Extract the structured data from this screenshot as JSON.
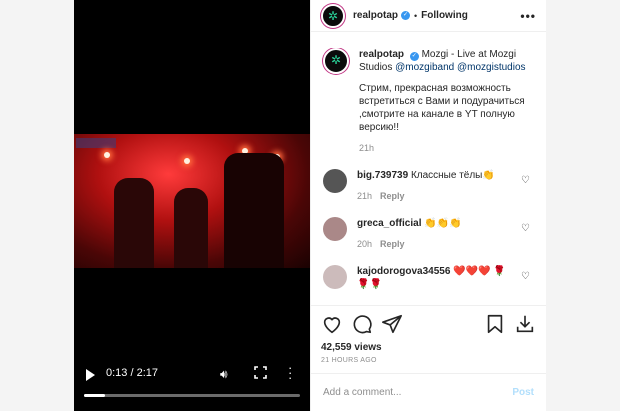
{
  "video": {
    "time": "0:13 / 2:17",
    "progress": 0.095
  },
  "header": {
    "username": "realpotap",
    "dot": "•",
    "follow": "Following",
    "more": "•••"
  },
  "caption": {
    "username": "realpotap",
    "title": "Mozgi - Live at Mozgi Studios",
    "mention1": "@mozgiband",
    "mention2": "@mozgistudios",
    "text": "Стрим, прекрасная возможность встретиться с Вами и подурачиться ,смотрите на канале в YT полную версию!!",
    "time": "21h"
  },
  "comments": [
    {
      "username": "big.739739",
      "text": "Классные тёлы👏",
      "time": "21h",
      "reply": "Reply"
    },
    {
      "username": "greca_official",
      "text": "👏👏👏",
      "time": "20h",
      "reply": "Reply"
    },
    {
      "username": "kajodorogova34556",
      "text": "❤️❤️❤️ 🌹🌹🌹",
      "time": "",
      "reply": ""
    }
  ],
  "stats": {
    "views": "42,559 views",
    "ago": "21 HOURS AGO"
  },
  "comment_box": {
    "placeholder": "Add a comment...",
    "post": "Post"
  },
  "colors": {
    "accent": "#3897f0",
    "post_disabled": "#b2dffc"
  }
}
